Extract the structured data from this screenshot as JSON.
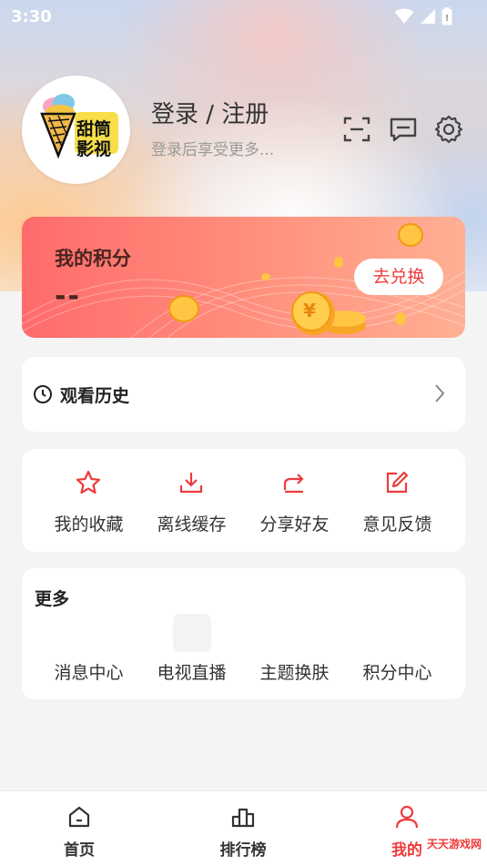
{
  "status_bar": {
    "time": "3:30"
  },
  "profile": {
    "avatar_text_line1": "甜筒",
    "avatar_text_line2": "影视",
    "login_title": "登录 / 注册",
    "login_subtitle": "登录后享受更多..."
  },
  "points": {
    "title": "我的积分",
    "value": "--",
    "redeem_label": "去兑换",
    "coin_symbol": "¥"
  },
  "history": {
    "label": "观看历史"
  },
  "actions": [
    {
      "label": "我的收藏",
      "icon": "star-icon"
    },
    {
      "label": "离线缓存",
      "icon": "download-icon"
    },
    {
      "label": "分享好友",
      "icon": "share-icon"
    },
    {
      "label": "意见反馈",
      "icon": "edit-icon"
    }
  ],
  "more": {
    "title": "更多",
    "items": [
      {
        "label": "消息中心"
      },
      {
        "label": "电视直播"
      },
      {
        "label": "主题换肤"
      },
      {
        "label": "积分中心"
      }
    ]
  },
  "tabbar": [
    {
      "label": "首页",
      "icon": "home-icon",
      "active": false
    },
    {
      "label": "排行榜",
      "icon": "ranking-icon",
      "active": false
    },
    {
      "label": "我的",
      "icon": "profile-icon",
      "active": true
    }
  ],
  "colors": {
    "accent": "#ee3b3b",
    "points_start": "#ff6b6b",
    "points_end": "#ffb094"
  },
  "watermark": "天天游戏网"
}
